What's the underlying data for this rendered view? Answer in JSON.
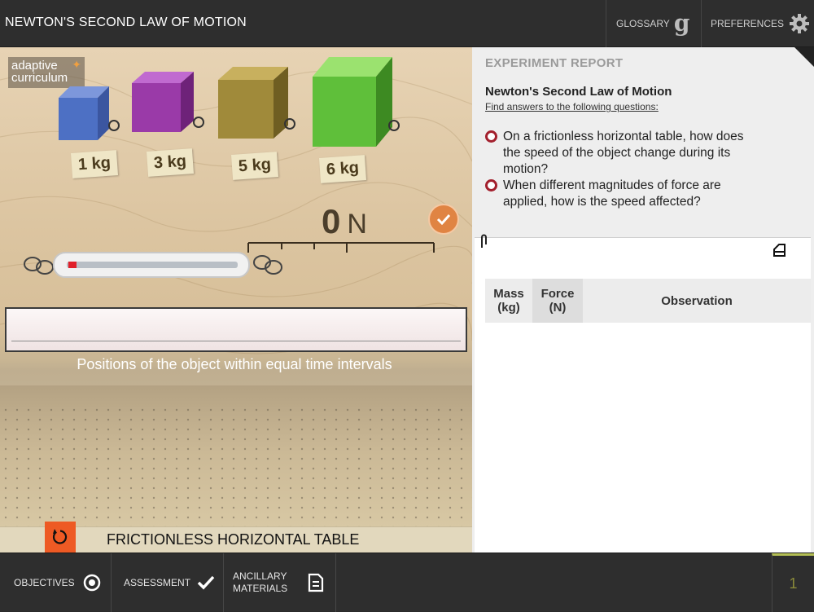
{
  "header": {
    "title": "NEWTON'S SECOND LAW OF MOTION",
    "glossary_label": "GLOSSARY",
    "preferences_label": "PREFERENCES"
  },
  "simulation": {
    "logo_line1": "adaptive",
    "logo_line2": "curriculum",
    "masses": [
      "1 kg",
      "3 kg",
      "5 kg",
      "6 kg"
    ],
    "force_value": "0",
    "force_unit": "N",
    "track_caption": "Positions of the object within equal time intervals",
    "table_label": "FRICTIONLESS HORIZONTAL TABLE",
    "colors": {
      "cube_1": "#4d70c4",
      "cube_3": "#9a3aa8",
      "cube_5": "#a08a3a",
      "cube_6": "#5fbf3a",
      "accent_orange": "#ee5a24"
    }
  },
  "report": {
    "heading": "EXPERIMENT REPORT",
    "title": "Newton's Second Law of Motion",
    "subtitle": "Find answers to the following questions:",
    "questions": [
      "On a frictionless horizontal table, how does the speed of the object change during its motion?",
      "When different magnitudes of force are applied, how is the speed affected?"
    ],
    "table_headers": {
      "mass": "Mass (kg)",
      "force": "Force (N)",
      "observation": "Observation"
    }
  },
  "footer": {
    "objectives_label": "OBJECTIVES",
    "assessment_label": "ASSESSMENT",
    "ancillary_label": "ANCILLARY MATERIALS",
    "page_number": "1"
  }
}
